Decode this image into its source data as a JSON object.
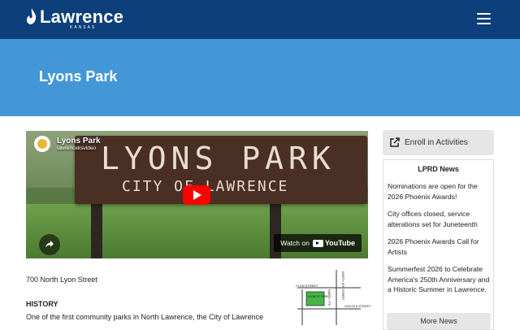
{
  "header": {
    "logo_text": "Lawrence",
    "logo_subtext": "KANSAS",
    "menu_icon": "hamburger-menu-icon",
    "background": "#0d3f7a"
  },
  "hero": {
    "title": "Lyons Park",
    "background": "#4497d7"
  },
  "video": {
    "title": "Lyons Park",
    "channel": "lawrenceksvideo",
    "sign_line1": "LYONS PARK",
    "sign_line2": "CITY OF LAWRENCE",
    "watch_on": "Watch on",
    "youtube_label": "YouTube"
  },
  "main": {
    "address": "700 North Lyon Street",
    "history_heading": "HISTORY",
    "history_text": "One of the first community parks in North Lawrence, the City of Lawrence",
    "map": {
      "street_1": "LYON STREET",
      "park_label": "LYON ST. PARK",
      "street_2": "NORTH 7TH",
      "street_3": "NORTH 8TH STREET",
      "street_4": "LINCOLN STREET"
    }
  },
  "sidebar": {
    "enroll_label": "Enroll in Activities",
    "enroll_icon": "external-link-icon",
    "news_heading": "LPRD News",
    "news_items": [
      "Nominations are open for the 2026 Phoenix Awards!",
      "City offices closed, service alterations set for Juneteenth",
      "2026 Phoenix Awards Call for Artists",
      "Summerfest 2026 to Celebrate America's 250th Anniversary and a Historic Summer in Lawrence."
    ],
    "more_news_label": "More News"
  }
}
